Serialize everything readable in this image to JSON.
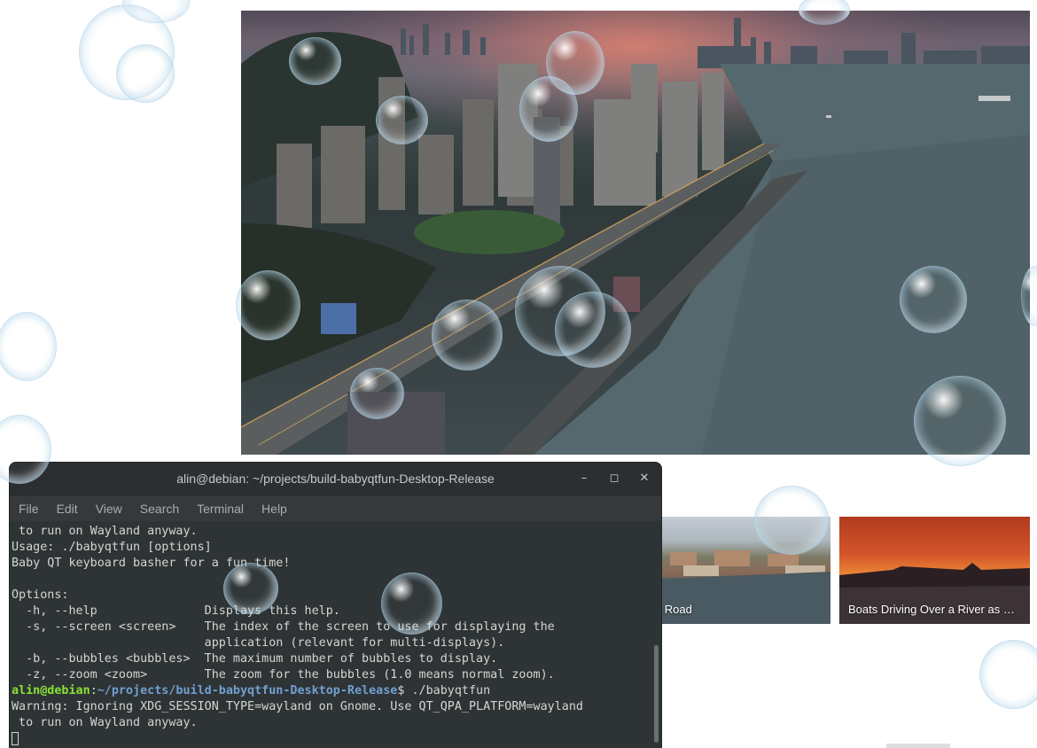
{
  "hero": {
    "image_alt": "Aerial view of a city waterfront with highway at dusk"
  },
  "thumbnails": [
    {
      "title": "ty Road",
      "icon": "city-photo"
    },
    {
      "title": "Boats Driving Over a River as …",
      "icon": "sunset-photo"
    }
  ],
  "terminal": {
    "title": "alin@debian: ~/projects/build-babyqtfun-Desktop-Release",
    "buttons": {
      "minimize": "–",
      "maximize": "◻",
      "close": "✕"
    },
    "menu": [
      "File",
      "Edit",
      "View",
      "Search",
      "Terminal",
      "Help"
    ],
    "lines": [
      " to run on Wayland anyway.",
      "Usage: ./babyqtfun [options]",
      "Baby QT keyboard basher for a fun time!",
      "",
      "Options:",
      "  -h, --help               Displays this help.",
      "  -s, --screen <screen>    The index of the screen to use for displaying the",
      "                           application (relevant for multi-displays).",
      "  -b, --bubbles <bubbles>  The maximum number of bubbles to display.",
      "  -z, --zoom <zoom>        The zoom for the bubbles (1.0 means normal zoom)."
    ],
    "prompt": {
      "user": "alin@debian",
      "sep": ":",
      "path": "~/projects/build-babyqtfun-Desktop-Release",
      "symbol": "$",
      "command": " ./babyqtfun"
    },
    "after_lines": [
      "Warning: Ignoring XDG_SESSION_TYPE=wayland on Gnome. Use QT_QPA_PLATFORM=wayland",
      " to run on Wayland anyway."
    ]
  }
}
